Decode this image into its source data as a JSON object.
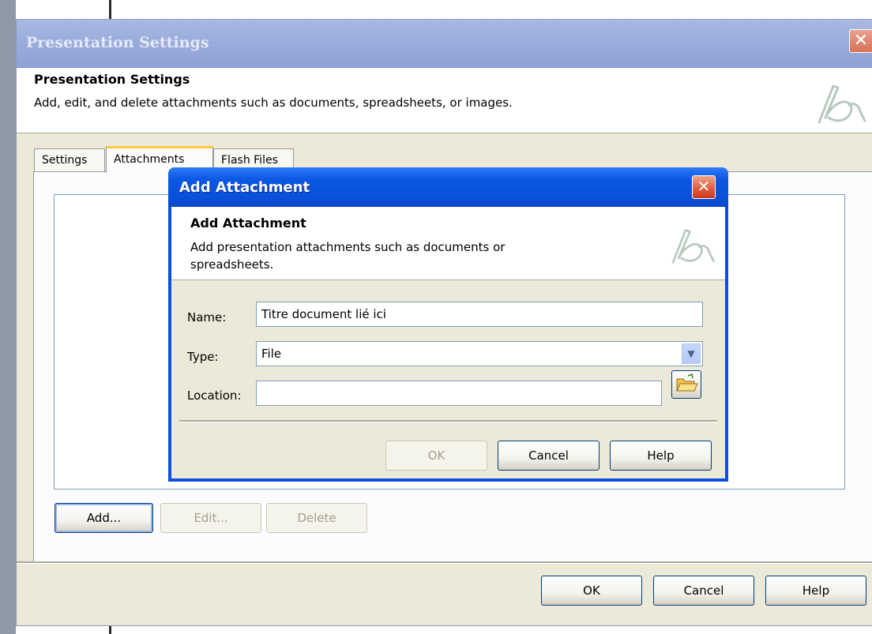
{
  "main_window": {
    "title": "Presentation Settings",
    "header_title": "Presentation Settings",
    "header_description": "Add, edit, and delete attachments such as documents, spreadsheets, or images.",
    "close_glyph": "✕",
    "tabs": [
      {
        "label": "Settings"
      },
      {
        "label": "Attachments",
        "selected": true
      },
      {
        "label": "Flash Files"
      }
    ],
    "list_buttons": {
      "add": "Add...",
      "edit": "Edit...",
      "delete": "Delete"
    },
    "footer_buttons": {
      "ok": "OK",
      "cancel": "Cancel",
      "help": "Help"
    }
  },
  "dialog": {
    "title": "Add Attachment",
    "close_glyph": "✕",
    "header_title": "Add Attachment",
    "header_description": "Add presentation attachments such as documents or spreadsheets.",
    "fields": {
      "name": {
        "label": "Name:",
        "value": "Titre document lié ici"
      },
      "type": {
        "label": "Type:",
        "value": "File"
      },
      "location": {
        "label": "Location:",
        "value": ""
      }
    },
    "buttons": {
      "ok": "OK",
      "cancel": "Cancel",
      "help": "Help"
    }
  },
  "icons": [
    "close-icon",
    "logo-icon",
    "dropdown-arrow-icon",
    "folder-open-icon"
  ],
  "colors": {
    "title_active": "#0a4fd9",
    "title_inactive": "#9caedc",
    "dialog_face": "#ece9d8",
    "tab_highlight": "#ffc83c"
  }
}
